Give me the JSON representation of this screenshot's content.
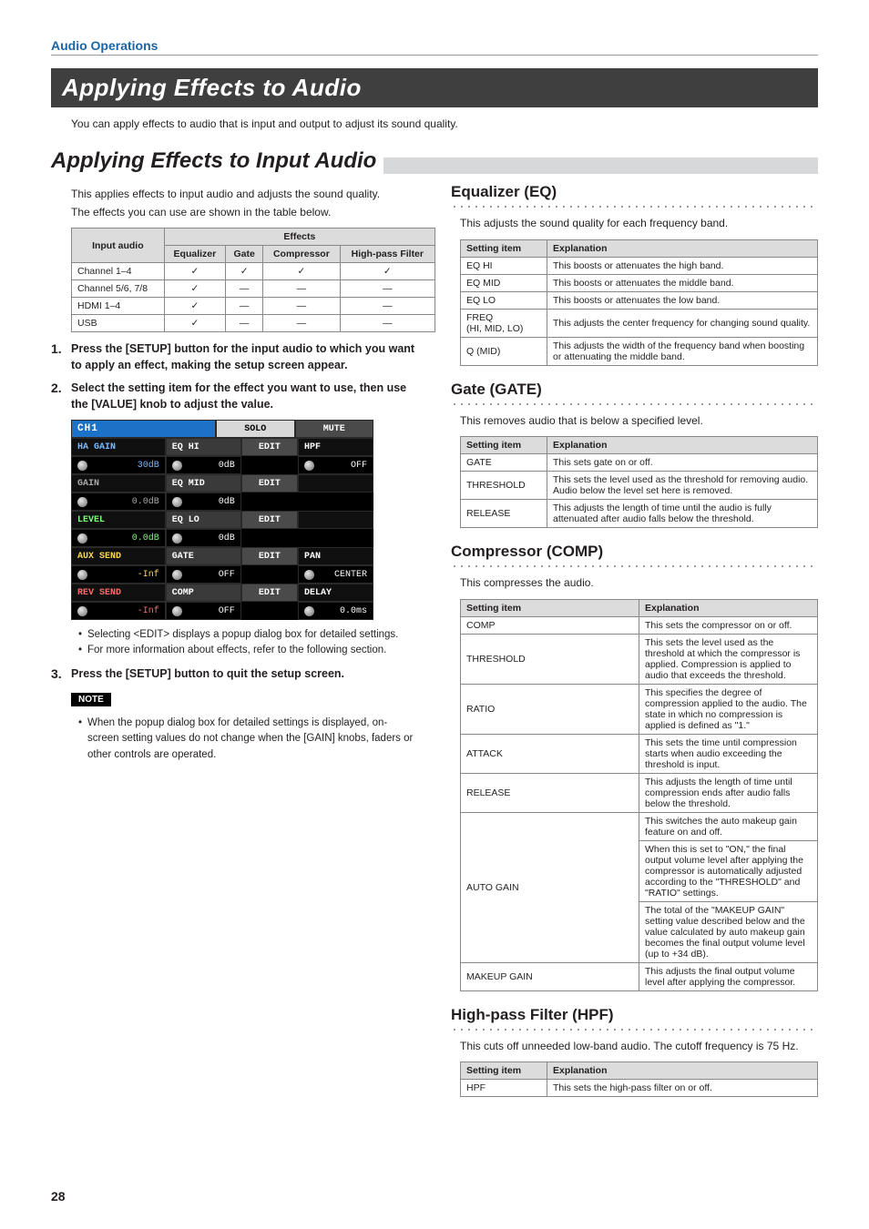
{
  "page_number": "28",
  "header": {
    "section": "Audio Operations"
  },
  "h1": "Applying Effects to Audio",
  "intro": "You can apply effects to audio that is input and output to adjust its sound quality.",
  "h2": "Applying Effects to Input Audio",
  "left": {
    "intro_line1": "This applies effects to input audio and adjusts the sound quality.",
    "intro_line2": "The effects you can use are shown in the table below.",
    "effects_table": {
      "head_input": "Input audio",
      "head_effects": "Effects",
      "cols": [
        "Equalizer",
        "Gate",
        "Compressor",
        "High-pass Filter"
      ],
      "rows": [
        {
          "label": "Channel 1–4",
          "vals": [
            "✓",
            "✓",
            "✓",
            "✓"
          ]
        },
        {
          "label": "Channel 5/6, 7/8",
          "vals": [
            "✓",
            "—",
            "—",
            "—"
          ]
        },
        {
          "label": "HDMI 1–4",
          "vals": [
            "✓",
            "—",
            "—",
            "—"
          ]
        },
        {
          "label": "USB",
          "vals": [
            "✓",
            "—",
            "—",
            "—"
          ]
        }
      ]
    },
    "steps": [
      {
        "n": "1.",
        "text": "Press the [SETUP] button for the input audio to which you want to apply an effect, making the setup screen appear."
      },
      {
        "n": "2.",
        "text": "Select the setting item for the effect you want to use, then use the [VALUE] knob to adjust the value."
      }
    ],
    "ui": {
      "title": "CH1",
      "tabs": [
        "SOLO",
        "MUTE"
      ],
      "rows": [
        [
          "HA GAIN",
          "30dB",
          "EQ HI",
          "EDIT",
          "0dB",
          "HPF",
          "OFF"
        ],
        [
          "GAIN",
          "0.0dB",
          "EQ MID",
          "EDIT",
          "0dB",
          "",
          ""
        ],
        [
          "LEVEL",
          "0.0dB",
          "EQ LO",
          "EDIT",
          "0dB",
          "",
          ""
        ],
        [
          "AUX SEND",
          "-Inf",
          "GATE",
          "EDIT",
          "OFF",
          "PAN",
          "CENTER"
        ],
        [
          "REV SEND",
          "-Inf",
          "COMP",
          "EDIT",
          "OFF",
          "DELAY",
          "0.0ms"
        ]
      ],
      "colors": [
        "c-blue",
        "c-gray",
        "c-green",
        "c-yellow",
        "c-red"
      ]
    },
    "step2_bullets": [
      "Selecting <EDIT> displays a popup dialog box for detailed settings.",
      "For more information about effects, refer to the following section."
    ],
    "step3": {
      "n": "3.",
      "text": "Press the [SETUP] button to quit the setup screen."
    },
    "note_label": "NOTE",
    "note_bullet": "When the popup dialog box for detailed settings is displayed, on-screen setting values do not change when the [GAIN] knobs, faders or other controls are operated."
  },
  "right": {
    "eq": {
      "title": "Equalizer (EQ)",
      "intro": "This adjusts the sound quality for each frequency band.",
      "head": [
        "Setting item",
        "Explanation"
      ],
      "rows": [
        [
          "EQ HI",
          "This boosts or attenuates the high band."
        ],
        [
          "EQ MID",
          "This boosts or attenuates the middle band."
        ],
        [
          "EQ LO",
          "This boosts or attenuates the low band."
        ],
        [
          "FREQ\n(HI, MID, LO)",
          "This adjusts the center frequency for changing sound quality."
        ],
        [
          "Q (MID)",
          "This adjusts the width of the frequency band when boosting or attenuating the middle band."
        ]
      ]
    },
    "gate": {
      "title": "Gate (GATE)",
      "intro": "This removes audio that is below a specified level.",
      "head": [
        "Setting item",
        "Explanation"
      ],
      "rows": [
        [
          "GATE",
          "This sets gate on or off."
        ],
        [
          "THRESHOLD",
          "This sets the level used as the threshold for removing audio. Audio below the level set here is removed."
        ],
        [
          "RELEASE",
          "This adjusts the length of time until the audio is fully attenuated after audio falls below the threshold."
        ]
      ]
    },
    "comp": {
      "title": "Compressor (COMP)",
      "intro": "This compresses the audio.",
      "head": [
        "Setting item",
        "Explanation"
      ],
      "rows": [
        [
          "COMP",
          "This sets the compressor on or off."
        ],
        [
          "THRESHOLD",
          "This sets the level used as the threshold at which the compressor is applied. Compression is applied to audio that exceeds the threshold."
        ],
        [
          "RATIO",
          "This specifies the degree of compression applied to the audio. The state in which no compression is applied is defined as \"1.\""
        ],
        [
          "ATTACK",
          "This sets the time until compression starts when audio exceeding the threshold is input."
        ],
        [
          "RELEASE",
          "This adjusts the length of time until compression ends after audio falls below the threshold."
        ]
      ],
      "autogain_label": "AUTO GAIN",
      "autogain_paras": [
        "This switches the auto makeup gain feature on and off.",
        "When this is set to \"ON,\" the final output volume level after applying the compressor is automatically adjusted according to the \"THRESHOLD\" and \"RATIO\" settings.",
        "The total of the \"MAKEUP GAIN\" setting value described below and the value calculated by auto makeup gain becomes the final output volume level (up to +34 dB)."
      ],
      "makeup_row": [
        "MAKEUP GAIN",
        "This adjusts the final output volume level after applying the compressor."
      ]
    },
    "hpf": {
      "title": "High-pass Filter (HPF)",
      "intro": "This cuts off unneeded low-band audio. The cutoff frequency is 75 Hz.",
      "head": [
        "Setting item",
        "Explanation"
      ],
      "rows": [
        [
          "HPF",
          "This sets the high-pass filter on or off."
        ]
      ]
    }
  }
}
